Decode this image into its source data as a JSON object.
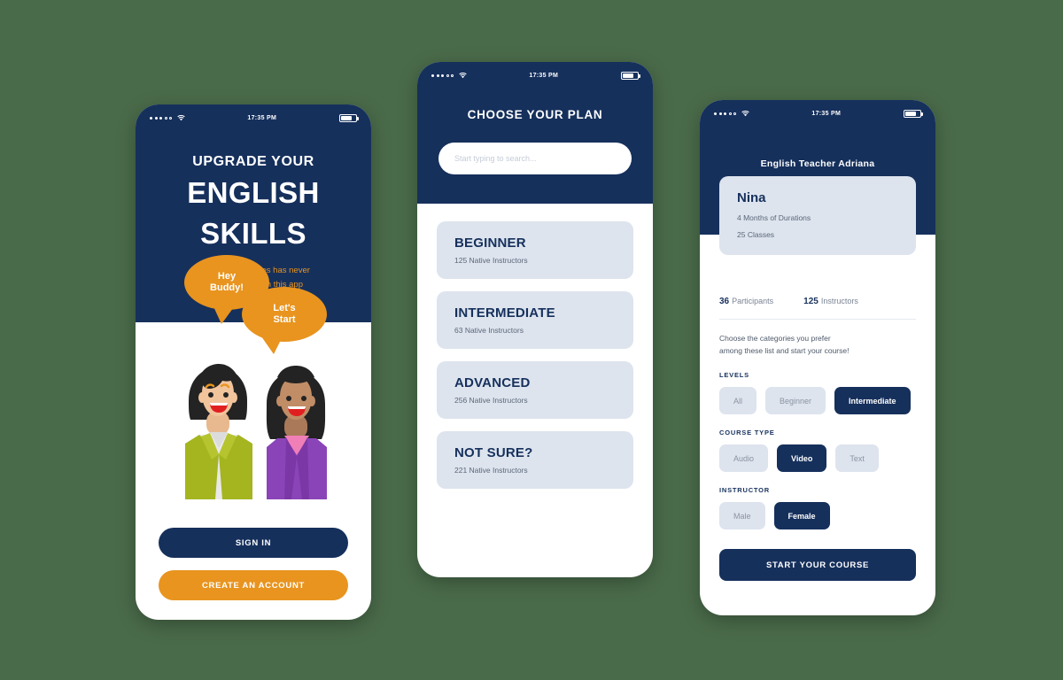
{
  "background_color": "#4a6b4a",
  "theme": {
    "navy": "#16305c",
    "orange": "#e8941f",
    "card": "#dde4ee"
  },
  "status_bar": {
    "time": "17:35 PM",
    "icons": [
      "signal-dots",
      "wifi-icon",
      "battery-icon"
    ]
  },
  "phone1": {
    "title": "UPGRADE YOUR",
    "headline_line1": "ENGLISH",
    "headline_line2": "SKILLS",
    "subtitle_line1": "Learning languages has never",
    "subtitle_line2": "been so easy with this app",
    "bubble1_line1": "Hey",
    "bubble1_line2": "Buddy!",
    "bubble2_line1": "Let's",
    "bubble2_line2": "Start",
    "sign_in_label": "SIGN IN",
    "create_account_label": "CREATE AN ACCOUNT"
  },
  "phone2": {
    "header": "CHOOSE YOUR PLAN",
    "search_placeholder": "Start typing to search...",
    "plans": [
      {
        "name": "BEGINNER",
        "detail": "125 Native Instructors"
      },
      {
        "name": "INTERMEDIATE",
        "detail": "63 Native Instructors"
      },
      {
        "name": "ADVANCED",
        "detail": "256 Native Instructors"
      },
      {
        "name": "NOT SURE?",
        "detail": "221 Native Instructors"
      }
    ]
  },
  "phone3": {
    "header": "English Teacher Adriana",
    "course": {
      "name": "Nina",
      "duration": "4 Months of Durations",
      "classes": "25 Classes"
    },
    "stats": [
      {
        "value": "36",
        "label": "Participants"
      },
      {
        "value": "125",
        "label": "Instructors"
      }
    ],
    "description_line1": "Choose the categories you prefer",
    "description_line2": "among these list and start your course!",
    "sections": [
      {
        "label": "LEVELS",
        "options": [
          {
            "text": "All",
            "selected": false
          },
          {
            "text": "Beginner",
            "selected": false
          },
          {
            "text": "Intermediate",
            "selected": true
          }
        ]
      },
      {
        "label": "COURSE TYPE",
        "options": [
          {
            "text": "Audio",
            "selected": false
          },
          {
            "text": "Video",
            "selected": true
          },
          {
            "text": "Text",
            "selected": false
          }
        ]
      },
      {
        "label": "INSTRUCTOR",
        "options": [
          {
            "text": "Male",
            "selected": false
          },
          {
            "text": "Female",
            "selected": true
          }
        ]
      }
    ],
    "start_button": "START YOUR COURSE"
  }
}
